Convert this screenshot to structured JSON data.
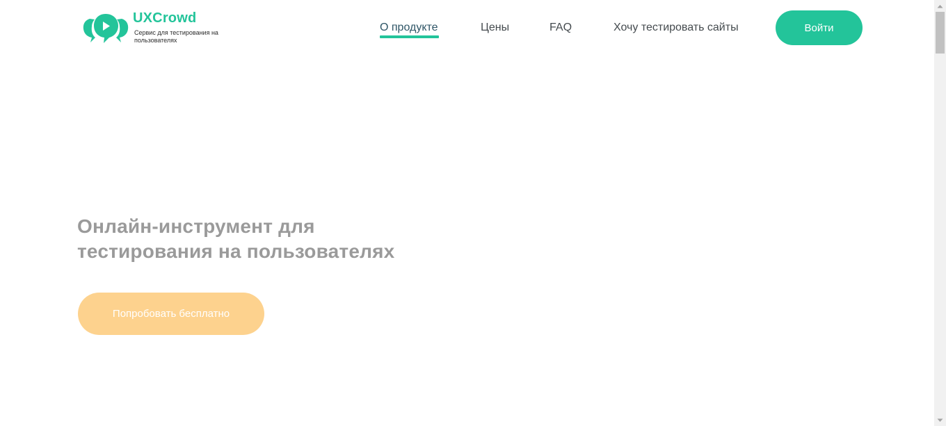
{
  "brand": {
    "name": "UXCrowd",
    "tagline": "Сервис для тестирования на пользователях",
    "accent_color": "#23c49a",
    "logo_icon": "speech-bubbles-play-icon"
  },
  "nav": {
    "items": [
      {
        "label": "О продукте",
        "active": true
      },
      {
        "label": "Цены",
        "active": false
      },
      {
        "label": "FAQ",
        "active": false
      },
      {
        "label": "Хочу тестировать сайты",
        "active": false
      }
    ],
    "login_label": "Войти"
  },
  "hero": {
    "title": "Онлайн-инструмент для тестирования на пользователях",
    "cta_label": "Попробовать бесплатно",
    "cta_color": "#fdd28e"
  },
  "scrollbar": {
    "up_icon": "scroll-up-arrow-icon",
    "down_icon": "scroll-down-arrow-icon"
  }
}
